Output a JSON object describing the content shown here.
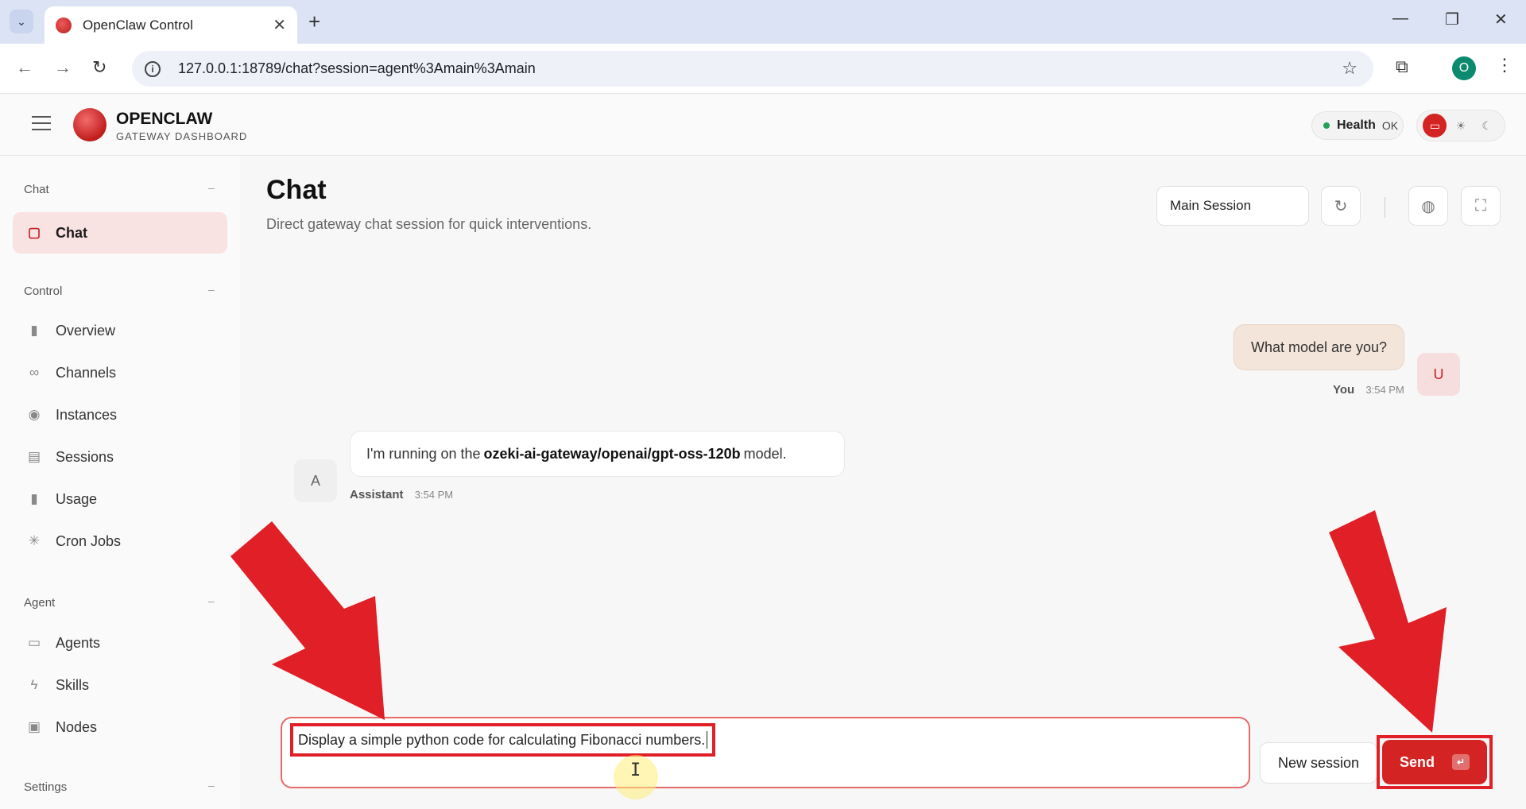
{
  "browser": {
    "tab_title": "OpenClaw Control",
    "url": "127.0.0.1:18789/chat?session=agent%3Amain%3Amain",
    "profile_initial": "O"
  },
  "app": {
    "brand_title": "OPENCLAW",
    "brand_subtitle": "GATEWAY DASHBOARD",
    "health_label": "Health",
    "health_value": "OK",
    "accent_color": "#d32323"
  },
  "sidebar": {
    "sections": [
      {
        "label": "Chat",
        "items": [
          {
            "label": "Chat",
            "icon": "message-icon",
            "active": true
          }
        ]
      },
      {
        "label": "Control",
        "items": [
          {
            "label": "Overview",
            "icon": "bar-chart-icon"
          },
          {
            "label": "Channels",
            "icon": "link-icon"
          },
          {
            "label": "Instances",
            "icon": "broadcast-icon"
          },
          {
            "label": "Sessions",
            "icon": "document-icon"
          },
          {
            "label": "Usage",
            "icon": "bar-chart-icon"
          },
          {
            "label": "Cron Jobs",
            "icon": "loader-icon"
          }
        ]
      },
      {
        "label": "Agent",
        "items": [
          {
            "label": "Agents",
            "icon": "folder-icon"
          },
          {
            "label": "Skills",
            "icon": "lightning-icon"
          },
          {
            "label": "Nodes",
            "icon": "monitor-icon"
          }
        ]
      },
      {
        "label": "Settings",
        "items": []
      }
    ]
  },
  "main": {
    "title": "Chat",
    "subtitle": "Direct gateway chat session for quick interventions.",
    "session_select": "Main Session",
    "messages": [
      {
        "role": "user",
        "name": "You",
        "avatar": "U",
        "text": "What model are you?",
        "time": "3:54 PM"
      },
      {
        "role": "assistant",
        "name": "Assistant",
        "avatar": "A",
        "text_before": "I'm running on the",
        "text_bold": "ozeki-ai-gateway/openai/gpt-oss-120b",
        "text_after": "model.",
        "time": "3:54 PM"
      }
    ],
    "composer_value": "Display a simple python code for calculating Fibonacci numbers.",
    "new_session_label": "New session",
    "send_label": "Send",
    "send_key": "↵"
  }
}
